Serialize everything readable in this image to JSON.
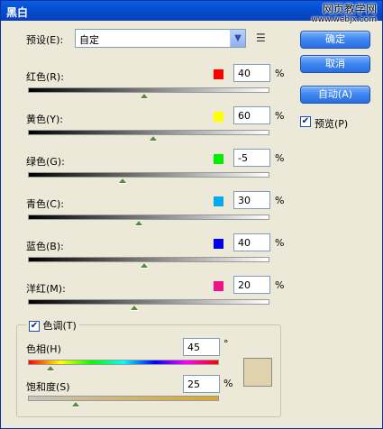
{
  "window": {
    "title": "黑白",
    "watermark_main": "网页教学网",
    "watermark_sub": "www.webjx.com"
  },
  "preset": {
    "label": "预设(E):",
    "value": "自定",
    "menu_icon": "panel-menu-icon"
  },
  "buttons": {
    "ok": "确定",
    "cancel": "取消",
    "auto": "自动(A)"
  },
  "preview": {
    "label": "预览(P)",
    "checked": true
  },
  "channels": [
    {
      "label": "红色(R):",
      "value": "40",
      "unit": "%",
      "color": "#ff0000",
      "slider_fraction": 0.48
    },
    {
      "label": "黄色(Y):",
      "value": "60",
      "unit": "%",
      "color": "#ffff00",
      "slider_fraction": 0.52
    },
    {
      "label": "绿色(G):",
      "value": "-5",
      "unit": "%",
      "color": "#00ee00",
      "slider_fraction": 0.39
    },
    {
      "label": "青色(C):",
      "value": "30",
      "unit": "%",
      "color": "#00aaee",
      "slider_fraction": 0.46
    },
    {
      "label": "蓝色(B):",
      "value": "40",
      "unit": "%",
      "color": "#0000ee",
      "slider_fraction": 0.48
    },
    {
      "label": "洋红(M):",
      "value": "20",
      "unit": "%",
      "color": "#ee1188",
      "slider_fraction": 0.44
    }
  ],
  "tint": {
    "label": "色调(T)",
    "checked": true,
    "hue_label": "色相(H)",
    "hue_value": "45",
    "hue_unit": "°",
    "hue_slider_fraction": 0.12,
    "saturation_label": "饱和度(S)",
    "saturation_value": "25",
    "saturation_unit": "%",
    "saturation_slider_fraction": 0.25,
    "swatch_color": "#dfd3ad"
  }
}
